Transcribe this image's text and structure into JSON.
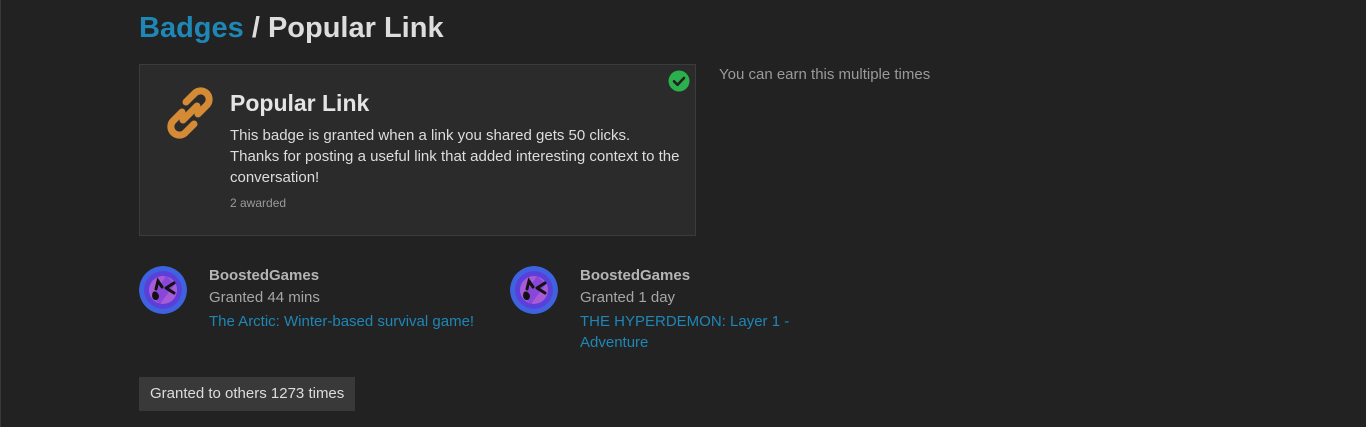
{
  "header": {
    "breadcrumb_link": "Badges",
    "separator": " / ",
    "title": "Popular Link"
  },
  "badge": {
    "icon": "link-icon",
    "icon_color": "#d58a35",
    "status_icon": "check-circle-icon",
    "status_color": "#2ab14d",
    "name": "Popular Link",
    "description": "This badge is granted when a link you shared gets 50 clicks. Thanks for posting a useful link that added interesting context to the conversation!",
    "awarded": "2 awarded"
  },
  "multiple_note": "You can earn this multiple times",
  "grants": [
    {
      "avatar": "user-avatar",
      "username": "BoostedGames",
      "granted": "Granted 44 mins",
      "topic": "The Arctic: Winter-based survival game!"
    },
    {
      "avatar": "user-avatar",
      "username": "BoostedGames",
      "granted": "Granted 1 day",
      "topic": "THE HYPERDEMON: Layer 1 - Adventure"
    }
  ],
  "others_button": "Granted to others 1273 times",
  "colors": {
    "background": "#222222",
    "card": "#2b2b2b",
    "link": "#1e87b6",
    "text": "#dddddd"
  }
}
